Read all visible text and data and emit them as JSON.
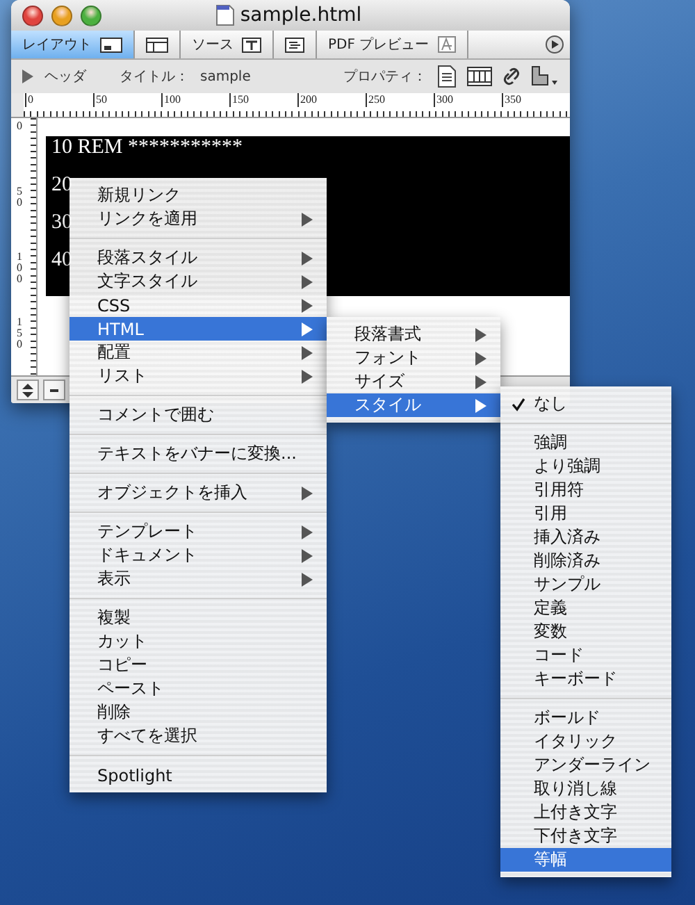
{
  "window": {
    "title": "sample.html",
    "tabs": [
      {
        "kind": "labeled",
        "label": "レイアウト",
        "selected": true
      },
      {
        "kind": "icon",
        "selected": false
      },
      {
        "kind": "labeled",
        "label": "ソース",
        "selected": false
      },
      {
        "kind": "icon",
        "selected": false
      },
      {
        "kind": "labeled",
        "label": "PDF プレビュー",
        "selected": false
      }
    ],
    "header": {
      "toggle_label": "ヘッダ",
      "title_label": "タイトル：",
      "title_value": "sample",
      "properties_label": "プロパティ："
    },
    "ruler": {
      "horizontal": [
        "0",
        "50",
        "100",
        "150",
        "200",
        "250",
        "300",
        "350"
      ],
      "vertical": [
        "0",
        "50",
        "100",
        "150"
      ]
    },
    "code_lines": [
      "10 REM ***********",
      "20",
      "30",
      "40"
    ]
  },
  "menus": {
    "main": [
      {
        "kind": "item",
        "label": "新規リンク",
        "submenu": false,
        "selected": false
      },
      {
        "kind": "item",
        "label": "リンクを適用",
        "submenu": true,
        "selected": false
      },
      {
        "kind": "separator"
      },
      {
        "kind": "item",
        "label": "段落スタイル",
        "submenu": true,
        "selected": false
      },
      {
        "kind": "item",
        "label": "文字スタイル",
        "submenu": true,
        "selected": false
      },
      {
        "kind": "item",
        "label": "CSS",
        "submenu": true,
        "selected": false
      },
      {
        "kind": "item",
        "label": "HTML",
        "submenu": true,
        "selected": true
      },
      {
        "kind": "item",
        "label": "配置",
        "submenu": true,
        "selected": false
      },
      {
        "kind": "item",
        "label": "リスト",
        "submenu": true,
        "selected": false
      },
      {
        "kind": "separator"
      },
      {
        "kind": "item",
        "label": "コメントで囲む",
        "submenu": false,
        "selected": false
      },
      {
        "kind": "separator"
      },
      {
        "kind": "item",
        "label": "テキストをバナーに変換...",
        "submenu": false,
        "selected": false
      },
      {
        "kind": "separator"
      },
      {
        "kind": "item",
        "label": "オブジェクトを挿入",
        "submenu": true,
        "selected": false
      },
      {
        "kind": "separator"
      },
      {
        "kind": "item",
        "label": "テンプレート",
        "submenu": true,
        "selected": false
      },
      {
        "kind": "item",
        "label": "ドキュメント",
        "submenu": true,
        "selected": false
      },
      {
        "kind": "item",
        "label": "表示",
        "submenu": true,
        "selected": false
      },
      {
        "kind": "separator"
      },
      {
        "kind": "item",
        "label": "複製",
        "submenu": false,
        "selected": false
      },
      {
        "kind": "item",
        "label": "カット",
        "submenu": false,
        "selected": false
      },
      {
        "kind": "item",
        "label": "コピー",
        "submenu": false,
        "selected": false
      },
      {
        "kind": "item",
        "label": "ペースト",
        "submenu": false,
        "selected": false
      },
      {
        "kind": "item",
        "label": "削除",
        "submenu": false,
        "selected": false
      },
      {
        "kind": "item",
        "label": "すべてを選択",
        "submenu": false,
        "selected": false
      },
      {
        "kind": "separator"
      },
      {
        "kind": "item",
        "label": "Spotlight",
        "submenu": false,
        "selected": false
      }
    ],
    "html_submenu": [
      {
        "kind": "item",
        "label": "段落書式",
        "submenu": true,
        "selected": false
      },
      {
        "kind": "item",
        "label": "フォント",
        "submenu": true,
        "selected": false
      },
      {
        "kind": "item",
        "label": "サイズ",
        "submenu": true,
        "selected": false
      },
      {
        "kind": "item",
        "label": "スタイル",
        "submenu": true,
        "selected": true
      }
    ],
    "style_submenu": [
      {
        "kind": "item",
        "label": "なし",
        "checked": true,
        "selected": false
      },
      {
        "kind": "separator"
      },
      {
        "kind": "item",
        "label": "強調",
        "checked": false,
        "selected": false
      },
      {
        "kind": "item",
        "label": "より強調",
        "checked": false,
        "selected": false
      },
      {
        "kind": "item",
        "label": "引用符",
        "checked": false,
        "selected": false
      },
      {
        "kind": "item",
        "label": "引用",
        "checked": false,
        "selected": false
      },
      {
        "kind": "item",
        "label": "挿入済み",
        "checked": false,
        "selected": false
      },
      {
        "kind": "item",
        "label": "削除済み",
        "checked": false,
        "selected": false
      },
      {
        "kind": "item",
        "label": "サンプル",
        "checked": false,
        "selected": false
      },
      {
        "kind": "item",
        "label": "定義",
        "checked": false,
        "selected": false
      },
      {
        "kind": "item",
        "label": "変数",
        "checked": false,
        "selected": false
      },
      {
        "kind": "item",
        "label": "コード",
        "checked": false,
        "selected": false
      },
      {
        "kind": "item",
        "label": "キーボード",
        "checked": false,
        "selected": false
      },
      {
        "kind": "separator"
      },
      {
        "kind": "item",
        "label": "ボールド",
        "checked": false,
        "selected": false
      },
      {
        "kind": "item",
        "label": "イタリック",
        "checked": false,
        "selected": false
      },
      {
        "kind": "item",
        "label": "アンダーライン",
        "checked": false,
        "selected": false
      },
      {
        "kind": "item",
        "label": "取り消し線",
        "checked": false,
        "selected": false
      },
      {
        "kind": "item",
        "label": "上付き文字",
        "checked": false,
        "selected": false
      },
      {
        "kind": "item",
        "label": "下付き文字",
        "checked": false,
        "selected": false
      },
      {
        "kind": "item",
        "label": "等幅",
        "checked": false,
        "selected": true
      }
    ]
  }
}
